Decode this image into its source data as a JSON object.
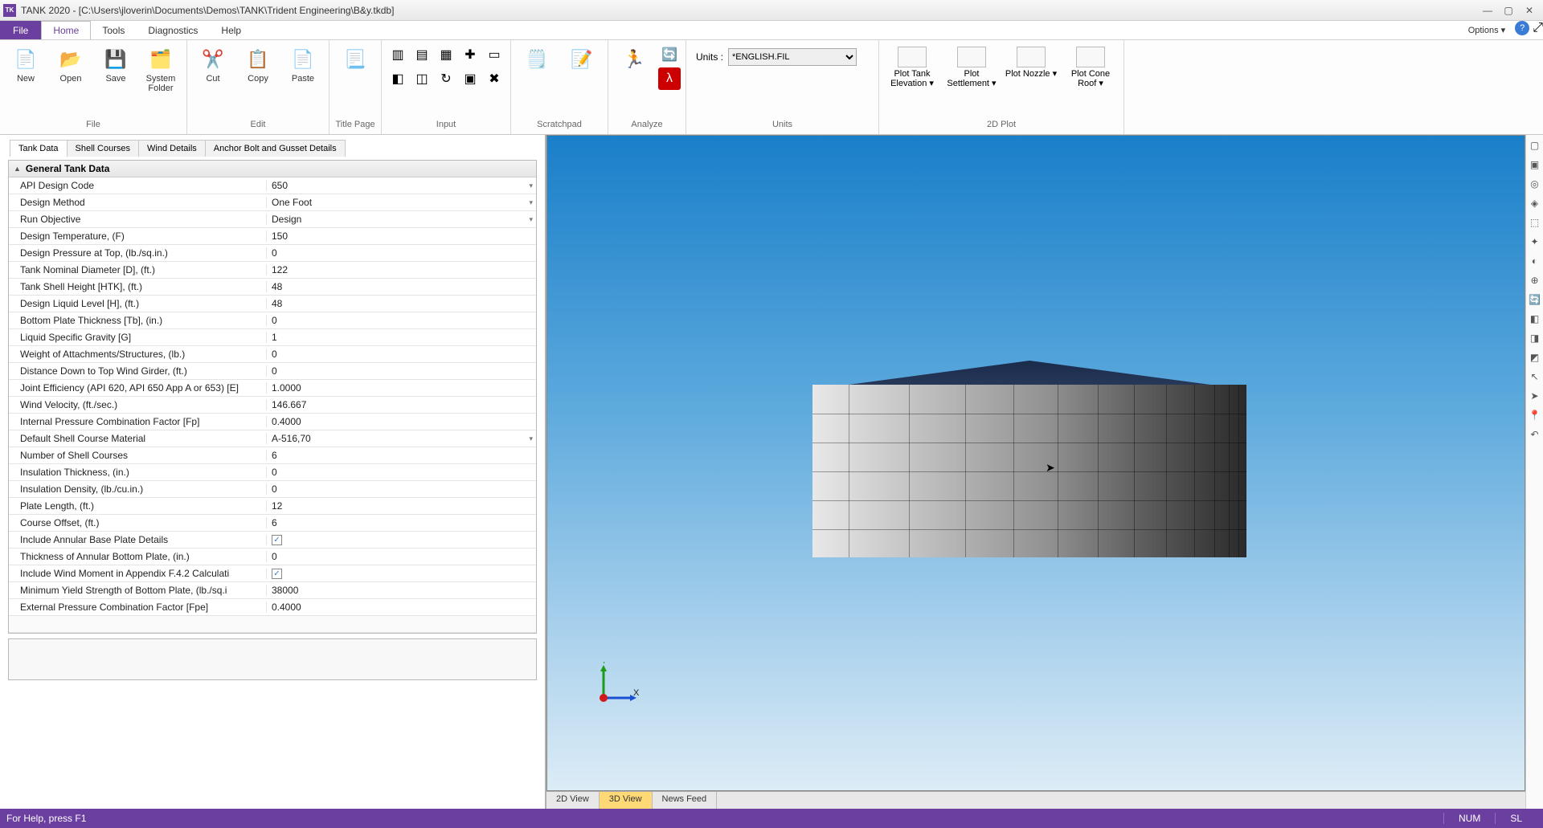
{
  "titlebar": {
    "app_icon_text": "TK",
    "title": "TANK 2020 - [C:\\Users\\jloverin\\Documents\\Demos\\TANK\\Trident Engineering\\B&y.tkdb]"
  },
  "menu": {
    "file": "File",
    "tabs": [
      "Home",
      "Tools",
      "Diagnostics",
      "Help"
    ],
    "options": "Options ▾"
  },
  "ribbon": {
    "file_group": "File",
    "new": "New",
    "open": "Open",
    "save": "Save",
    "system_folder": "System Folder",
    "edit_group": "Edit",
    "cut": "Cut",
    "copy": "Copy",
    "paste": "Paste",
    "title_page_group": "Title Page",
    "input_group": "Input",
    "scratchpad_group": "Scratchpad",
    "analyze_group": "Analyze",
    "units_group": "Units",
    "units_label": "Units :",
    "units_value": "*ENGLISH.FIL",
    "plot_group": "2D Plot",
    "plot_tank_elev": "Plot Tank Elevation ▾",
    "plot_settlement": "Plot Settlement ▾",
    "plot_nozzle": "Plot Nozzle ▾",
    "plot_cone_roof": "Plot Cone Roof ▾"
  },
  "prop_tabs": [
    "Tank Data",
    "Shell Courses",
    "Wind Details",
    "Anchor Bolt and Gusset Details"
  ],
  "section_title": "General Tank Data",
  "props": [
    {
      "k": "API Design Code",
      "v": "650",
      "dd": true
    },
    {
      "k": "Design Method",
      "v": "One Foot",
      "dd": true
    },
    {
      "k": "Run Objective",
      "v": "Design",
      "dd": true
    },
    {
      "k": "Design Temperature, (F)",
      "v": "150"
    },
    {
      "k": "Design Pressure at Top, (lb./sq.in.)",
      "v": "0"
    },
    {
      "k": "Tank Nominal Diameter [D], (ft.)",
      "v": "122"
    },
    {
      "k": "Tank Shell Height [HTK], (ft.)",
      "v": "48"
    },
    {
      "k": "Design Liquid Level [H], (ft.)",
      "v": "48"
    },
    {
      "k": "Bottom Plate Thickness [Tb], (in.)",
      "v": "0"
    },
    {
      "k": "Liquid Specific Gravity [G]",
      "v": "1"
    },
    {
      "k": "Weight of Attachments/Structures, (lb.)",
      "v": "0"
    },
    {
      "k": "Distance Down to Top Wind Girder, (ft.)",
      "v": "0"
    },
    {
      "k": "Joint Efficiency (API 620, API 650 App A or 653) [E]",
      "v": "1.0000"
    },
    {
      "k": "Wind Velocity, (ft./sec.)",
      "v": "146.667"
    },
    {
      "k": "Internal Pressure Combination Factor [Fp]",
      "v": "0.4000"
    },
    {
      "k": "Default Shell Course Material",
      "v": "A-516,70",
      "dd": true
    },
    {
      "k": "Number of Shell Courses",
      "v": "6"
    },
    {
      "k": "Insulation Thickness, (in.)",
      "v": "0"
    },
    {
      "k": "Insulation Density, (lb./cu.in.)",
      "v": "0"
    },
    {
      "k": "Plate Length, (ft.)",
      "v": "12"
    },
    {
      "k": "Course Offset, (ft.)",
      "v": "6"
    },
    {
      "k": "Include Annular Base Plate Details",
      "v": "",
      "chk": true
    },
    {
      "k": "Thickness of Annular Bottom Plate, (in.)",
      "v": "0"
    },
    {
      "k": "Include Wind Moment in Appendix F.4.2 Calculati",
      "v": "",
      "chk": true
    },
    {
      "k": "Minimum Yield Strength of Bottom Plate, (lb./sq.i",
      "v": "38000"
    },
    {
      "k": "External Pressure Combination Factor  [Fpe]",
      "v": "0.4000"
    }
  ],
  "view_tabs": [
    "2D View",
    "3D View",
    "News Feed"
  ],
  "axis": {
    "y": "Y",
    "x": "X"
  },
  "status": {
    "help": "For Help, press F1",
    "num": "NUM",
    "sl": "SL"
  }
}
